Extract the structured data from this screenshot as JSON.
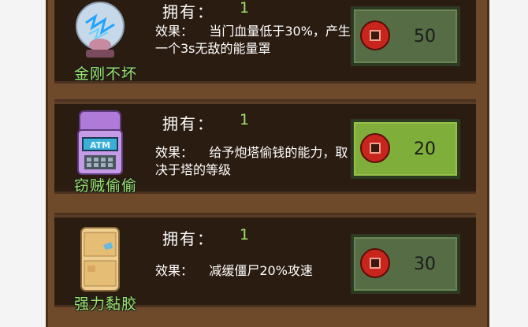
{
  "shop": {
    "items": [
      {
        "name": "金刚不坏",
        "own_label": "拥有：",
        "own_count": "1",
        "effect": "效果：    当门血量低于30%，产生一个3s无敌的能量罩",
        "price": "50",
        "icon": "crystal-ball-icon"
      },
      {
        "name": "窃贼偷偷",
        "own_label": "拥有：",
        "own_count": "1",
        "effect": "效果：    给予炮塔偷钱的能力，取决于塔的等级",
        "price": "20",
        "icon": "atm-machine-icon",
        "icon_text": "ATM"
      },
      {
        "name": "强力黏胶",
        "own_label": "拥有：",
        "own_count": "1",
        "effect": "效果：    减缓僵尸20%攻速",
        "price": "30",
        "icon": "glue-jar-icon"
      }
    ]
  },
  "colors": {
    "panel": "#6e4a2a",
    "card": "#2b1c12",
    "accent_green": "#9be36a",
    "button_active": "#7fae3a",
    "button_inactive": "#556c45",
    "coin": "#c8251c"
  }
}
